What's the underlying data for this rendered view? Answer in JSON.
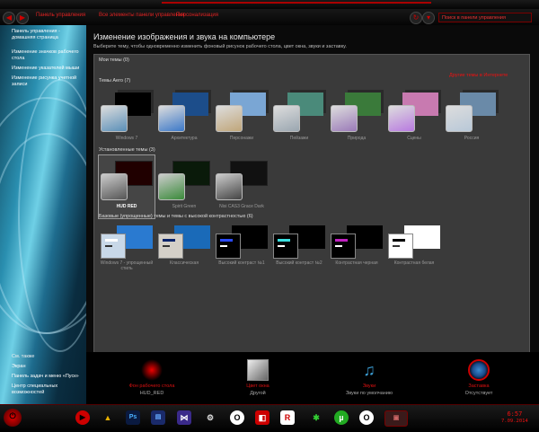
{
  "window": {
    "title": "Изменение изображения и звука на компьютере",
    "subtitle": "Выберите тему, чтобы одновременно изменить фоновый рисунок рабочего стола, цвет окна, звуки и заставку."
  },
  "address_bar": {
    "breadcrumbs": [
      "Панель управления",
      "Все элементы панели управления",
      "Персонализация"
    ],
    "search_placeholder": "Поиск в панели управления"
  },
  "sidebar": {
    "links": [
      "Панель управления - домашняя страница",
      "Изменение значков рабочего стола",
      "Изменение указателей мыши",
      "Изменение рисунка учетной записи"
    ],
    "see_also_title": "См. также",
    "see_also": [
      "Экран",
      "Панель задач и меню «Пуск»",
      "Центр специальных возможностей"
    ]
  },
  "themes": {
    "my_themes": "Мои темы (0)",
    "online_link": "Другие темы в Интернете",
    "aero_title": "Темы Aero (7)",
    "aero": [
      {
        "label": "Windows 7",
        "bg": "#000000",
        "fg": "#5a8fb8"
      },
      {
        "label": "Архитектура",
        "bg": "#1c4d8a",
        "fg": "#3b78c8"
      },
      {
        "label": "Персонажи",
        "bg": "#7aa6d4",
        "fg": "#c0a67a"
      },
      {
        "label": "Пейзажи",
        "bg": "#4a8a7a",
        "fg": "#9aa6b0"
      },
      {
        "label": "Природа",
        "bg": "#3a7a3a",
        "fg": "#9a7ab8"
      },
      {
        "label": "Сцены",
        "bg": "#c87ab0",
        "fg": "#b87ae0"
      },
      {
        "label": "Россия",
        "bg": "#6a8aa8",
        "fg": "#b8c8d8"
      }
    ],
    "installed_title": "Установленные темы (3)",
    "installed": [
      {
        "label": "HUD RED",
        "bg": "#200000",
        "fg": "#555555"
      },
      {
        "label": "Spirit Green",
        "bg": "#0a1a0a",
        "fg": "#3a8a3a"
      },
      {
        "label": "Nisi CAS3 Grace Dark",
        "bg": "#111111",
        "fg": "#444444"
      }
    ],
    "basic_title": "Базовые (упрощенные) темы и темы с высокой контрастностью (6)",
    "basic": [
      {
        "label": "Windows 7 - упрощенный стиль",
        "back": "#2a7ad0",
        "front": "#c8d8e8",
        "bar": "#ffffff"
      },
      {
        "label": "Классическая",
        "back": "#1a6ab8",
        "front": "#d4d0c8",
        "bar": "#0a246a"
      },
      {
        "label": "Высокий контраст №1",
        "back": "#000000",
        "front": "#000000",
        "bar": "#2a4aff"
      },
      {
        "label": "Высокий контраст №2",
        "back": "#000000",
        "front": "#000000",
        "bar": "#3ae0e0"
      },
      {
        "label": "Контрастная черная",
        "back": "#000000",
        "front": "#000000",
        "bar": "#c020c0"
      },
      {
        "label": "Контрастная белая",
        "back": "#ffffff",
        "front": "#ffffff",
        "bar": "#000000"
      }
    ]
  },
  "bottom": [
    {
      "l1": "Фон рабочего стола",
      "l2": "HUD_RED"
    },
    {
      "l1": "Цвет окна",
      "l2": "Другой"
    },
    {
      "l1": "Звуки",
      "l2": "Звуки по умолчанию"
    },
    {
      "l1": "Заставка",
      "l2": "Отсутствует"
    }
  ],
  "taskbar": {
    "time": "6:57",
    "date": "7.09.2014"
  }
}
